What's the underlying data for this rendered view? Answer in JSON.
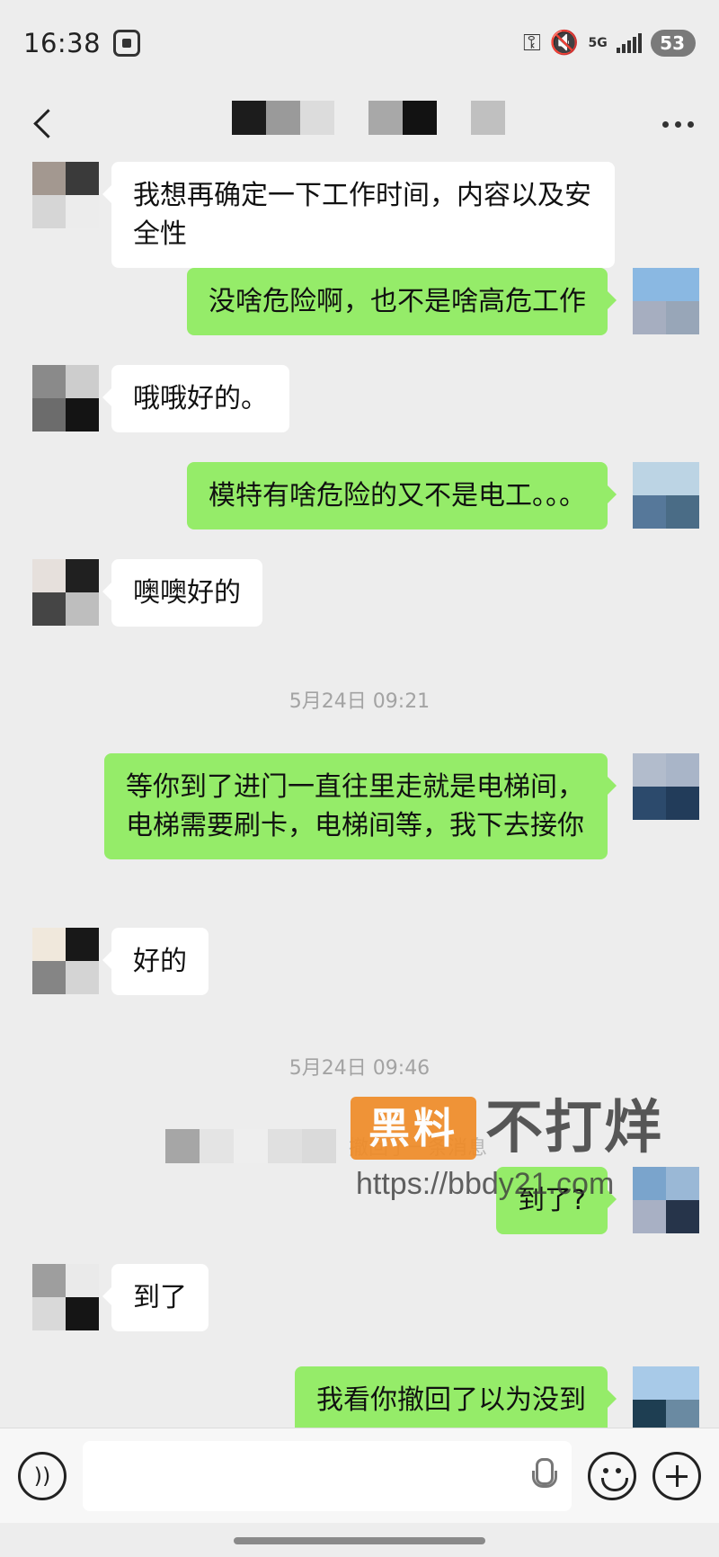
{
  "status_bar": {
    "time": "16:38",
    "network": "5G",
    "battery": "53"
  },
  "header": {
    "title_redacted_blocks": [
      "#1c1c1c",
      "#9a9a9a",
      "#dcdcdc",
      "#ededed",
      "#a8a8a8",
      "#121212",
      "#ededed",
      "#c0c0c0"
    ]
  },
  "messages": [
    {
      "side": "left",
      "text": "我想再确定一下工作时间，内容以及安全性",
      "avatar": [
        "#a39890",
        "#3a3a3a",
        "#d6d6d6",
        "#ececec"
      ]
    },
    {
      "side": "right",
      "text": "没啥危险啊，也不是啥高危工作",
      "avatar": [
        "#8ab8e2",
        "#8ab8e2",
        "#a6aec0",
        "#98a6b8"
      ]
    },
    {
      "side": "left",
      "text": "哦哦好的。",
      "avatar": [
        "#8a8a8a",
        "#cdcdcd",
        "#6c6c6c",
        "#141414"
      ]
    },
    {
      "side": "right",
      "text": "模特有啥危险的又不是电工。。。",
      "avatar": [
        "#bcd4e4",
        "#bcd4e4",
        "#56789a",
        "#4a6c86"
      ]
    },
    {
      "side": "left",
      "text": "噢噢好的",
      "avatar": [
        "#e6e0dc",
        "#202020",
        "#454545",
        "#bebebe"
      ]
    },
    {
      "side": "right",
      "text": "等你到了进门一直往里走就是电梯间，电梯需要刷卡，电梯间等，我下去接你",
      "avatar": [
        "#b2bccc",
        "#a9b5c8",
        "#2c4a6c",
        "#223c5a"
      ]
    },
    {
      "side": "left",
      "text": "好的",
      "avatar": [
        "#f0e8dc",
        "#181818",
        "#858585",
        "#d4d4d4"
      ]
    },
    {
      "side": "right",
      "text": "到了?",
      "avatar": [
        "#7aa4cc",
        "#9ab8d6",
        "#a8b0c4",
        "#26344a"
      ]
    },
    {
      "side": "left",
      "text": "到了",
      "avatar": [
        "#9e9e9e",
        "#eaeaea",
        "#d9d9d9",
        "#151515"
      ]
    },
    {
      "side": "right",
      "text": "我看你撤回了以为没到",
      "avatar": [
        "#a8cae8",
        "#a8cae8",
        "#1e3e52",
        "#6a8aa2"
      ]
    }
  ],
  "timestamps": [
    "5月24日 09:21",
    "5月24日 09:46"
  ],
  "recall_notice": {
    "text": "撤回了一条消息",
    "blocks": [
      "#a6a6a6",
      "#e4e4e4",
      "#eeeeee",
      "#e0e0e0",
      "#dadada"
    ]
  },
  "watermark": {
    "badge": "黑料",
    "title": "不打烊",
    "url": "https://bbdy21.com"
  },
  "input_bar": {
    "placeholder": ""
  }
}
